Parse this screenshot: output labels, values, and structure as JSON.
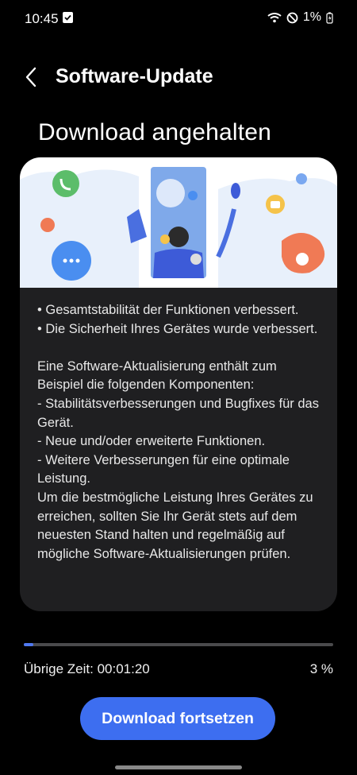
{
  "status_bar": {
    "time": "10:45",
    "battery": "1%"
  },
  "app_bar": {
    "title": "Software-Update"
  },
  "heading": "Download angehalten",
  "release_notes": "• Gesamtstabilität der Funktionen verbessert.\n• Die Sicherheit Ihres Gerätes wurde verbessert.\n\nEine Software-Aktualisierung enthält zum Beispiel die folgenden Komponenten:\n - Stabilitätsverbesserungen und Bugfixes für das Gerät.\n - Neue und/oder erweiterte Funktionen.\n - Weitere Verbesserungen für eine optimale Leistung.\nUm die bestmögliche Leistung Ihres Gerätes zu erreichen, sollten Sie Ihr Gerät stets auf dem neuesten Stand halten und regelmäßig auf mögliche Software-Aktualisierungen prüfen.",
  "progress": {
    "fraction": 0.03,
    "remaining_label": "Übrige Zeit: 00:01:20",
    "percent_label": "3 %"
  },
  "actions": {
    "resume_label": "Download fortsetzen"
  },
  "colors": {
    "accent": "#3d6ef0",
    "progress_fill": "#4f78f0",
    "card_background": "#1f1f21"
  }
}
